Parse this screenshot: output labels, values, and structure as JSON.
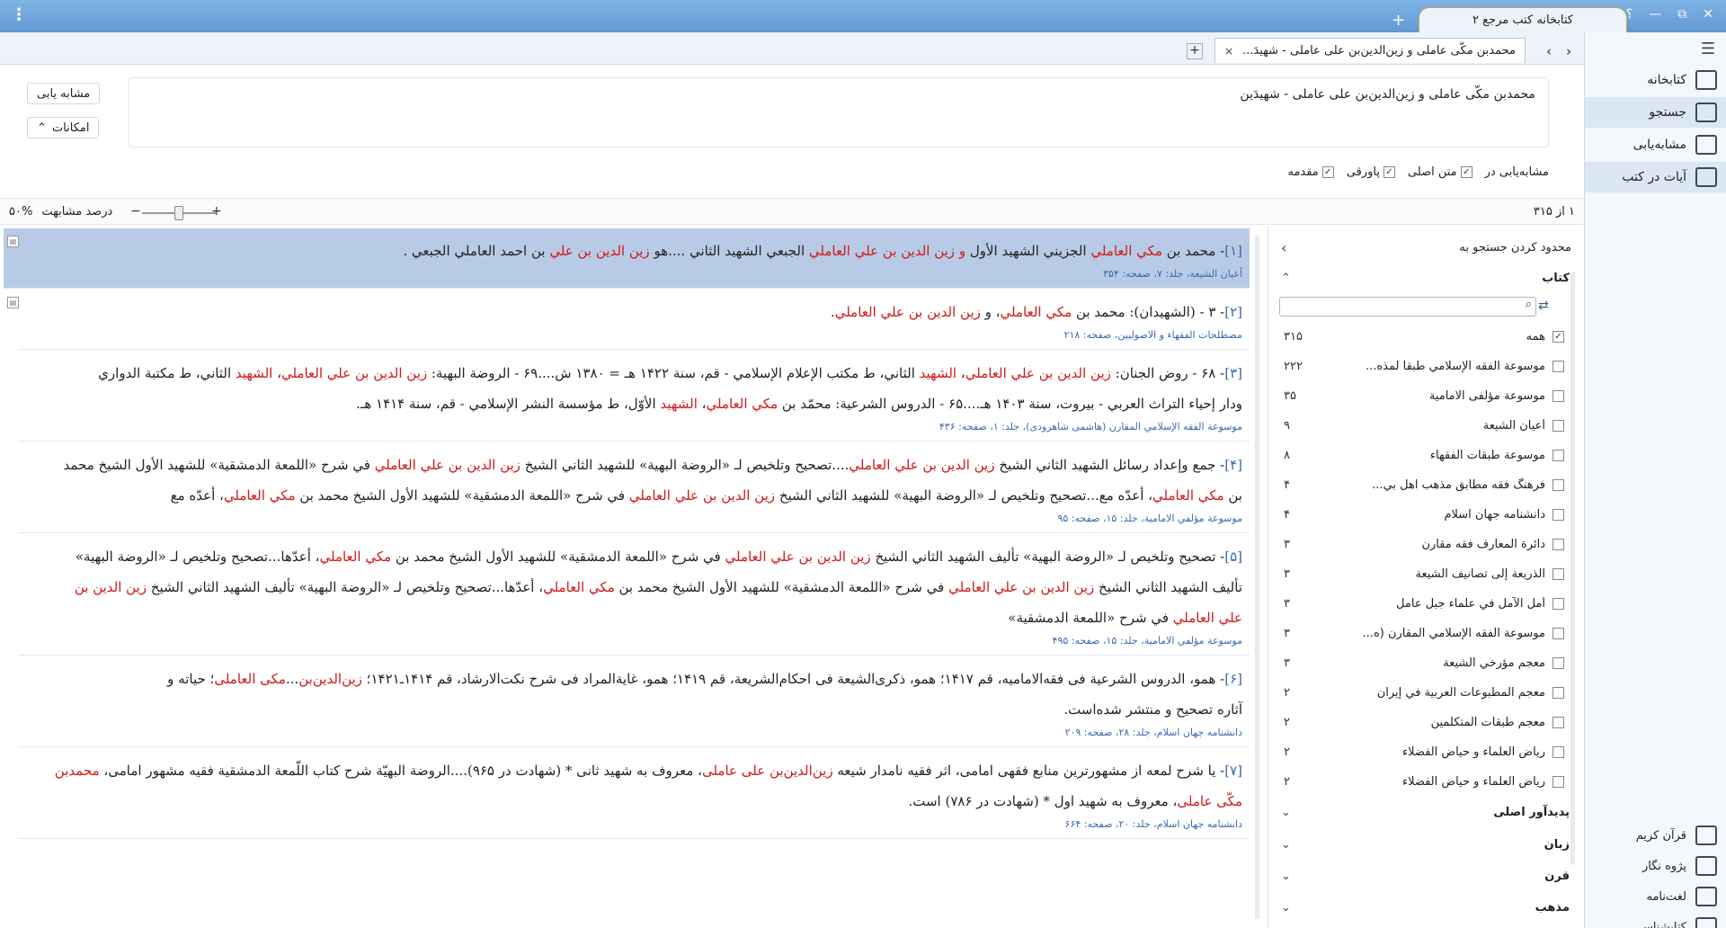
{
  "titlebar": {
    "app_title": "کتابخانه کتب مرجع ۲",
    "new_tab": "+",
    "help": "؟",
    "minimize": "—",
    "restore": "⧉",
    "close": "✕",
    "menu": "⋮"
  },
  "doc_tab": {
    "title": "محمدبن مکّی عاملی و زین‌الدین‌بن علی عاملی - شهیدَ...",
    "close": "×",
    "add": "+",
    "prev": "‹",
    "next": "›"
  },
  "sidebar": {
    "items": [
      {
        "label": "کتابخانه",
        "icon": "books-icon",
        "selected": false
      },
      {
        "label": "جستجو",
        "icon": "search-icon",
        "selected": true
      },
      {
        "label": "مشابه‌یابی",
        "icon": "similar-icon",
        "selected": false
      },
      {
        "label": "آیات در کتب",
        "icon": "verses-icon",
        "selected": true
      }
    ],
    "bottom": [
      {
        "label": "قرآن کریم",
        "icon": "quran-icon"
      },
      {
        "label": "پژوه نگار",
        "icon": "notes-icon"
      },
      {
        "label": "لغت‌نامه",
        "icon": "dictionary-icon"
      },
      {
        "label": "کتابشناسی",
        "icon": "info-icon"
      }
    ]
  },
  "search": {
    "query": "محمدبن مکّی عاملی و زین‌الدین‌بن علی عاملی - شهیدَین",
    "similar_button": "مشابه یابی",
    "options_button": "امکانات",
    "options_chevron": "⌃",
    "scope_label": "مشابه‌یابی در",
    "scope": [
      {
        "label": "متن اصلی",
        "checked": true
      },
      {
        "label": "پاورقی",
        "checked": true
      },
      {
        "label": "مقدمه",
        "checked": true
      }
    ]
  },
  "results_header": {
    "count": "۱ از ۳۱۵",
    "similarity_label": "درصد مشابهت",
    "similarity_value": "۵۰%",
    "similarity_fraction": 0.5
  },
  "results": [
    {
      "num": "[۱]",
      "selected": true,
      "lines": [
        [
          [
            "- محمد بن ",
            ""
          ],
          [
            "مكي العاملي",
            "red"
          ],
          [
            " الجزيني الشهيد الأول ",
            ""
          ],
          [
            "و زين الدين بن علي العاملي",
            "red"
          ],
          [
            " الجبعي الشهيد الثاني ....هو ",
            ""
          ],
          [
            "زين الدين بن علي",
            "red"
          ],
          [
            " بن احمد العاملي الجبعي .",
            ""
          ]
        ]
      ],
      "source": "أعيان الشيعة، جلد: ۷، صفحه: ۳۵۴"
    },
    {
      "num": "[۲]",
      "selected": false,
      "lines": [
        [
          [
            "- ۳ - (الشهيدان): محمد بن ",
            ""
          ],
          [
            "مكي العاملي",
            "red"
          ],
          [
            "، و ",
            ""
          ],
          [
            "زين الدين بن علي العاملي",
            "red"
          ],
          [
            ".",
            ""
          ]
        ]
      ],
      "source": "مصطلحات الفقهاء و الاصوليين، صفحه: ۲۱۸"
    },
    {
      "num": "[۳]",
      "selected": false,
      "lines": [
        [
          [
            "- ۶۸ - روض الجنان: ",
            ""
          ],
          [
            "زين الدين بن علي العاملي",
            "red"
          ],
          [
            "، ",
            ""
          ],
          [
            "الشهيد",
            "red"
          ],
          [
            " الثاني، ط مكتب الإعلام الإسلامي - قم، سنة ۱۴۲۲ هـ = ۱۳۸۰ ش....۶۹ - الروضة البهية: ",
            ""
          ],
          [
            "زين الدين بن علي العاملي",
            "red"
          ],
          [
            "، ",
            ""
          ],
          [
            "الشهيد",
            "red"
          ],
          [
            " الثاني، ط مكتبة الدواري",
            ""
          ]
        ],
        [
          [
            "ودار إحياء التراث العربي - بيروت، سنة ۱۴۰۳ هـ....۶۵ - الدروس الشرعية: محمّد بن ",
            ""
          ],
          [
            "مكي العاملي",
            "red"
          ],
          [
            "، ",
            ""
          ],
          [
            "الشهيد",
            "red"
          ],
          [
            " الأوّل، ط مؤسسة النشر الإسلامي - قم، سنة ۱۴۱۴ هـ.",
            ""
          ]
        ]
      ],
      "source": "موسوعة الفقه الإسلامي المقارن (هاشمى شاهرودى)، جلد: ۱، صفحه: ۴۳۶"
    },
    {
      "num": "[۴]",
      "selected": false,
      "lines": [
        [
          [
            "- جمع وإعداد رسائل الشهيد الثاني الشيخ ",
            ""
          ],
          [
            "زين الدين بن علي العاملي",
            "red"
          ],
          [
            "....تصحيح وتلخيص لـ «الروضة البهية» للشهيد الثاني الشيخ ",
            ""
          ],
          [
            "زين الدين بن علي العاملي",
            "red"
          ],
          [
            " في شرح «اللمعة الدمشقية» للشهيد الأول الشيخ محمد",
            ""
          ]
        ],
        [
          [
            "بن ",
            ""
          ],
          [
            "مكي العاملي",
            "red"
          ],
          [
            "، أعدّه مع...تصحيح وتلخيص لـ «الروضة البهية» للشهيد الثاني الشيخ ",
            ""
          ],
          [
            "زين الدين بن علي العاملي",
            "red"
          ],
          [
            " في شرح «اللمعة الدمشقية» للشهيد الأول الشيخ محمد بن ",
            ""
          ],
          [
            "مكي العاملي",
            "red"
          ],
          [
            "، أعدّه مع",
            ""
          ]
        ]
      ],
      "source": "موسوعة مؤلفي الامامية، جلد: ۱۵، صفحه: ۹۵"
    },
    {
      "num": "[۵]",
      "selected": false,
      "lines": [
        [
          [
            "- تصحيح وتلخيص لـ «الروضة البهية» تأليف الشهيد الثاني الشيخ ",
            ""
          ],
          [
            "زين الدين بن علي العاملي",
            "red"
          ],
          [
            " في شرح «اللمعة الدمشقية» للشهيد الأول الشيخ محمد بن ",
            ""
          ],
          [
            "مكي العاملي",
            "red"
          ],
          [
            "، أعدّها...تصحيح وتلخيص لـ «الروضة البهية»",
            ""
          ]
        ],
        [
          [
            "تأليف الشهيد الثاني الشيخ ",
            ""
          ],
          [
            "زين الدين بن علي العاملي",
            "red"
          ],
          [
            " في شرح «اللمعة الدمشقية» للشهيد الأول الشيخ محمد بن ",
            ""
          ],
          [
            "مكي العاملي",
            "red"
          ],
          [
            "، أعدّها...تصحيح وتلخيص لـ «الروضة البهية» تأليف الشهيد الثاني الشيخ ",
            ""
          ],
          [
            "زين الدين بن",
            "red"
          ]
        ],
        [
          [
            "علي العاملي",
            "red"
          ],
          [
            " في شرح «اللمعة الدمشقية»",
            ""
          ]
        ]
      ],
      "source": "موسوعة مؤلفي الامامية، جلد: ۱۵، صفحه: ۴۹۵"
    },
    {
      "num": "[۶]",
      "selected": false,
      "lines": [
        [
          [
            "- همو، الدروس الشرعية فى فقه‌الاماميه، قم ۱۴۱۷؛ همو، ذكرى‌الشيعة فى احكام‌الشريعة، قم ۱۴۱۹؛ همو، غاية‌المراد فى شرح نكت‌الارشاد، قم ۱۴۱۴ـ۱۴۲۱؛ ",
            ""
          ],
          [
            "زين‌الدين‌بن",
            "red"
          ],
          [
            "...",
            ""
          ],
          [
            "مكى العاملى",
            "red"
          ],
          [
            "؛ حياته و",
            ""
          ]
        ],
        [
          [
            "آثاره تصحيح و منتشر شده‌است.",
            ""
          ]
        ]
      ],
      "source": "دانشنامه جهان اسلام، جلد: ۲۸، صفحه: ۲۰۹"
    },
    {
      "num": "[۷]",
      "selected": false,
      "lines": [
        [
          [
            "- یا شرح لمعه از مشهورترین منابع فقهی امامی، اثر فقیه نامدار شیعه ",
            ""
          ],
          [
            "زین‌الدین‌بن علی عاملی",
            "red"
          ],
          [
            "، معروف به شهید ثانی * (شهادت در ۹۶۵)....الروضة البهیّة شرح کتاب اللّمعة الدمشقیة فقیه مشهور امامی، ",
            ""
          ],
          [
            "محمدبن",
            "red"
          ]
        ],
        [
          [
            "مکّی عاملی",
            "red"
          ],
          [
            "، معروف به شهید اول * (شهادت در ۷۸۶) است.",
            ""
          ]
        ]
      ],
      "source": "دانشنامه جهان اسلام، جلد: ۲۰، صفحه: ۶۶۴"
    }
  ],
  "filter": {
    "title": "محدود کردن جستجو به",
    "back": "‹",
    "books_section": "کتاب",
    "sort_icon": "⇄",
    "books": [
      {
        "label": "همه",
        "count": "۳۱۵",
        "checked": true
      },
      {
        "label": "موسوعة الفقه الإسلامي طبقا لمذه...",
        "count": "۲۲۲",
        "checked": false
      },
      {
        "label": "موسوعة مؤلفی الامامیة",
        "count": "۳۵",
        "checked": false
      },
      {
        "label": "أعيان الشيعة",
        "count": "۹",
        "checked": false
      },
      {
        "label": "موسوعة طبقات الفقهاء",
        "count": "۸",
        "checked": false
      },
      {
        "label": "فرهنگ فقه مطابق مذهب اهل بي...",
        "count": "۴",
        "checked": false
      },
      {
        "label": "دانشنامه جهان اسلام",
        "count": "۴",
        "checked": false
      },
      {
        "label": "دائرة المعارف فقه مقارن",
        "count": "۳",
        "checked": false
      },
      {
        "label": "الذريعة إلى تصانيف الشيعة",
        "count": "۳",
        "checked": false
      },
      {
        "label": "أمل الآمل في علماء جبل عامل",
        "count": "۳",
        "checked": false
      },
      {
        "label": "موسوعة الفقه الإسلامي المقارن (ه...",
        "count": "۳",
        "checked": false
      },
      {
        "label": "معجم مؤرخي الشيعة",
        "count": "۳",
        "checked": false
      },
      {
        "label": "معجم المطبوعات العربية في إيران",
        "count": "۲",
        "checked": false
      },
      {
        "label": "معجم طبقات المتكلمين",
        "count": "۲",
        "checked": false
      },
      {
        "label": "رياض العلماء و حياض الفضلاء",
        "count": "۲",
        "checked": false
      },
      {
        "label": "رياض العلماء و حياض الفضلاء",
        "count": "۲",
        "checked": false
      }
    ],
    "sections": [
      {
        "label": "پدیدآور اصلی"
      },
      {
        "label": "زبان"
      },
      {
        "label": "قرن"
      },
      {
        "label": "مذهب"
      }
    ]
  }
}
